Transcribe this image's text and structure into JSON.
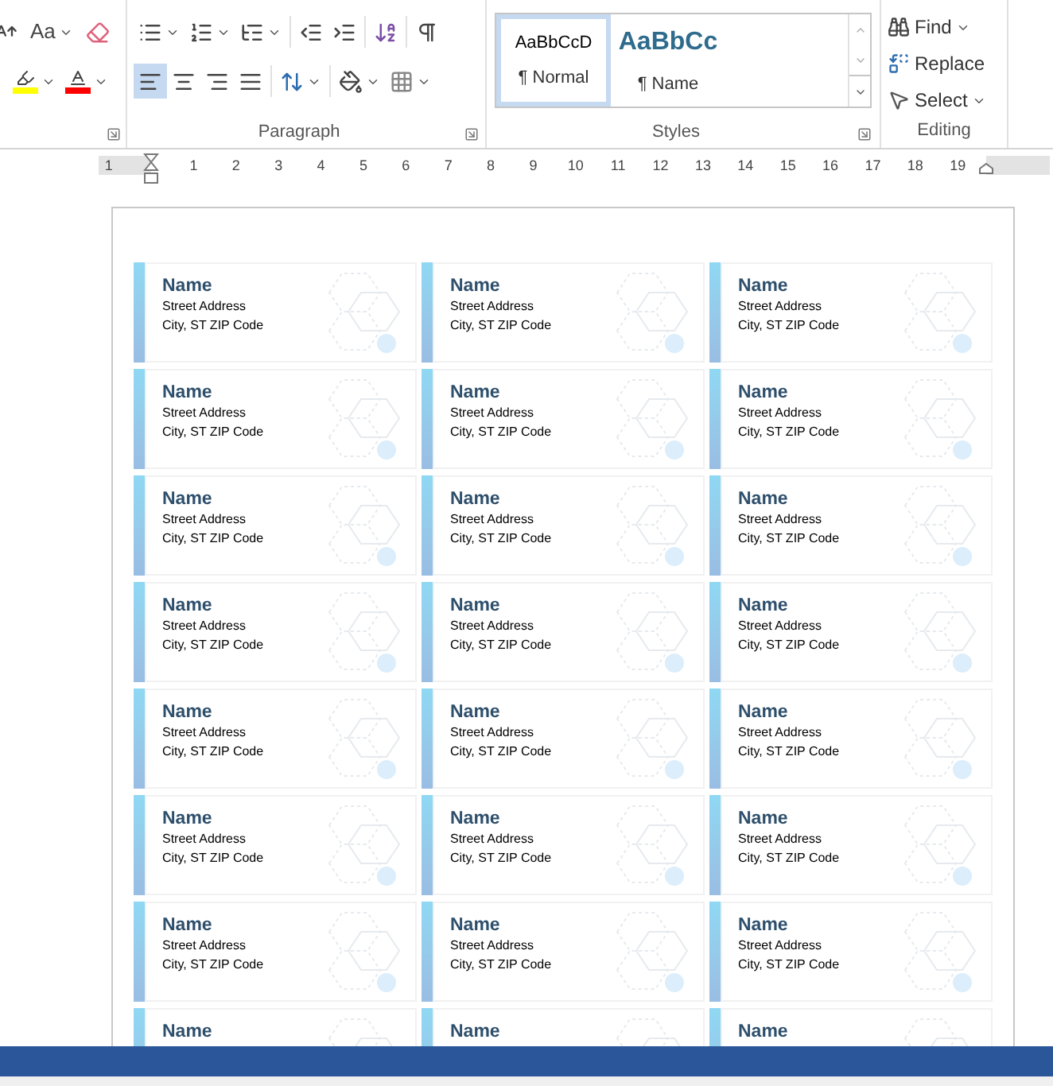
{
  "ribbon": {
    "font": {
      "change_case": "Aa"
    },
    "paragraph": {
      "label": "Paragraph",
      "alignments": [
        {
          "kind": "left",
          "selected": true
        },
        {
          "kind": "center",
          "selected": false
        },
        {
          "kind": "right",
          "selected": false
        },
        {
          "kind": "justify",
          "selected": false
        }
      ]
    },
    "styles": {
      "label": "Styles",
      "items": [
        {
          "preview": "AaBbCcD",
          "name": "¶ Normal",
          "selected": true
        },
        {
          "preview": "AaBbCc",
          "name": "¶ Name",
          "selected": false
        }
      ]
    },
    "editing": {
      "label": "Editing",
      "commands": [
        {
          "kind": "find",
          "label": "Find"
        },
        {
          "kind": "replace",
          "label": "Replace"
        },
        {
          "kind": "select",
          "label": "Select"
        }
      ]
    }
  },
  "ruler": {
    "labels": [
      "1",
      "1",
      "2",
      "3",
      "4",
      "5",
      "6",
      "7",
      "8",
      "9",
      "10",
      "11",
      "12",
      "13",
      "14",
      "15",
      "16",
      "17",
      "18",
      "19"
    ]
  },
  "label_rows": [
    [
      {
        "name": "Name",
        "street": "Street Address",
        "city": "City, ST ZIP Code"
      },
      {
        "name": "Name",
        "street": "Street Address",
        "city": "City, ST ZIP Code"
      },
      {
        "name": "Name",
        "street": "Street Address",
        "city": "City, ST ZIP Code"
      }
    ],
    [
      {
        "name": "Name",
        "street": "Street Address",
        "city": "City, ST ZIP Code"
      },
      {
        "name": "Name",
        "street": "Street Address",
        "city": "City, ST ZIP Code"
      },
      {
        "name": "Name",
        "street": "Street Address",
        "city": "City, ST ZIP Code"
      }
    ],
    [
      {
        "name": "Name",
        "street": "Street Address",
        "city": "City, ST ZIP Code"
      },
      {
        "name": "Name",
        "street": "Street Address",
        "city": "City, ST ZIP Code"
      },
      {
        "name": "Name",
        "street": "Street Address",
        "city": "City, ST ZIP Code"
      }
    ],
    [
      {
        "name": "Name",
        "street": "Street Address",
        "city": "City, ST ZIP Code"
      },
      {
        "name": "Name",
        "street": "Street Address",
        "city": "City, ST ZIP Code"
      },
      {
        "name": "Name",
        "street": "Street Address",
        "city": "City, ST ZIP Code"
      }
    ],
    [
      {
        "name": "Name",
        "street": "Street Address",
        "city": "City, ST ZIP Code"
      },
      {
        "name": "Name",
        "street": "Street Address",
        "city": "City, ST ZIP Code"
      },
      {
        "name": "Name",
        "street": "Street Address",
        "city": "City, ST ZIP Code"
      }
    ],
    [
      {
        "name": "Name",
        "street": "Street Address",
        "city": "City, ST ZIP Code"
      },
      {
        "name": "Name",
        "street": "Street Address",
        "city": "City, ST ZIP Code"
      },
      {
        "name": "Name",
        "street": "Street Address",
        "city": "City, ST ZIP Code"
      }
    ],
    [
      {
        "name": "Name",
        "street": "Street Address",
        "city": "City, ST ZIP Code"
      },
      {
        "name": "Name",
        "street": "Street Address",
        "city": "City, ST ZIP Code"
      },
      {
        "name": "Name",
        "street": "Street Address",
        "city": "City, ST ZIP Code"
      }
    ],
    [
      {
        "name": "Name"
      },
      {
        "name": "Name"
      },
      {
        "name": "Name"
      }
    ]
  ]
}
